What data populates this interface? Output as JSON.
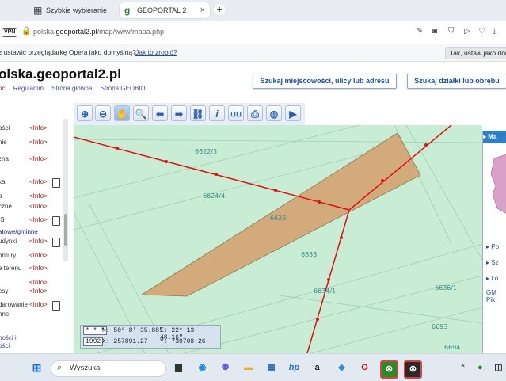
{
  "browser": {
    "tabs": [
      {
        "label": "Szybkie wybieranie",
        "icon": "grid-icon",
        "active": false
      },
      {
        "label": "GEOPORTAL 2",
        "icon": "geoportal-logo-icon",
        "active": true
      }
    ],
    "vpn_label": "VPN",
    "url_prefix": "polska.",
    "url_domain": "geoportal2.pl",
    "url_path": "/map/www/mapa.php",
    "default_msg": "z ustawić przeglądarkę Opera jako domyślną?",
    "default_link": "Jak to zrobić?",
    "default_btn": "Tak, ustaw jako domy"
  },
  "header": {
    "title": "olska.geoportal2.pl",
    "links": [
      "oc",
      "Regulamin",
      "Strona główna",
      "Strona GEOBID"
    ],
    "btn_search_place": "Szukaj miejscowości, ulicy lub adresu",
    "btn_search_parcel": "Szukaj działki lub obrębu"
  },
  "left_panel": {
    "rows": [
      {
        "label": "ości",
        "info": "<Info>",
        "doc": false
      },
      {
        "label": "nie",
        "info": "<Info>",
        "doc": false
      },
      {
        "label": "zna",
        "info": "<Info>",
        "doc": false
      },
      {
        "label": "ka",
        "info": "<Info>",
        "doc": true
      },
      {
        "label": "a",
        "info": "<Info>",
        "doc": false
      },
      {
        "label": "czne",
        "info": "<Info>",
        "doc": false
      },
      {
        "label": "IS",
        "info": "<Info>",
        "doc": true
      },
      {
        "label": "atowe/gminne",
        "info": "",
        "doc": false
      },
      {
        "label": "udynki",
        "info": "<Info>",
        "doc": true
      },
      {
        "label": "ontury",
        "info": "<Info>",
        "doc": false
      },
      {
        "label": "e terenu",
        "info": "<Info>",
        "doc": false
      },
      {
        "label": "",
        "info": "<Info>",
        "doc": false
      },
      {
        "label": "esy",
        "info": "<Info>",
        "doc": false
      },
      {
        "label": "darowanie",
        "info": "<Info>",
        "doc": true
      },
      {
        "label": "nne",
        "info": "",
        "doc": false
      }
    ],
    "bottom_line1": "ności i",
    "bottom_line2": "ości"
  },
  "toolbar": {
    "tools": [
      "zoom-in-icon",
      "zoom-out-icon",
      "pan-hand-icon",
      "zoom-window-icon",
      "back-arrow-icon",
      "forward-arrow-icon",
      "link-icon",
      "info-icon",
      "measure-icon",
      "print-icon",
      "globe-icon",
      "camera-icon"
    ]
  },
  "map": {
    "parcels": [
      "6622/3",
      "6624/4",
      "6626",
      "6633",
      "6634/1",
      "6636/1",
      "6693",
      "6694"
    ],
    "coords": {
      "scale_btn": "* * *",
      "epsg": "1992",
      "n": "N: 50° 8' 35.88\"",
      "e": "E: 22° 13' 48.16\"",
      "x": "X: 257891.27",
      "y": "Y: 730708.26"
    },
    "colors": {
      "background": "#c8ecd4",
      "parcel_fill": "#d2aa7c",
      "boundary": "#e01010"
    }
  },
  "right_panel": {
    "header": "Ma",
    "items": [
      "Po",
      "Sz",
      "Lo",
      "GM\nPik"
    ]
  },
  "taskbar": {
    "search_placeholder": "Wyszukaj",
    "apps": [
      "files-icon",
      "edge-icon",
      "teams-icon",
      "explorer-icon",
      "store-icon",
      "hp-icon",
      "amazon-icon",
      "photos-icon",
      "opera-icon",
      "xbox-icon",
      "xbox-alt-icon"
    ]
  }
}
